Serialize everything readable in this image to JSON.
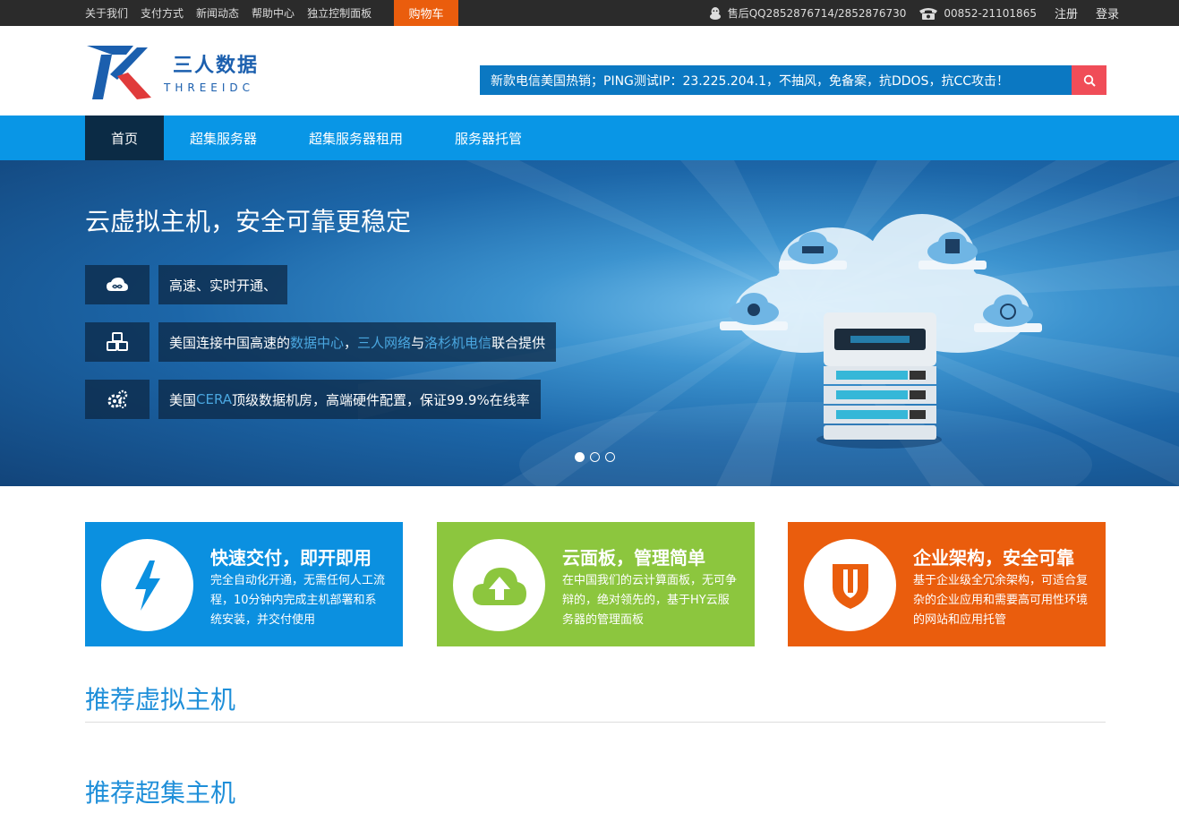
{
  "topbar": {
    "links": [
      "关于我们",
      "支付方式",
      "新闻动态",
      "帮助中心",
      "独立控制面板"
    ],
    "cart": "购物车",
    "qq": "售后QQ2852876714/2852876730",
    "phone": "00852-21101865",
    "register": "注册",
    "login": "登录"
  },
  "header": {
    "logo_cn": "三人数据",
    "logo_en": "THREEIDC",
    "marquee": "新款电信美国热销；PING测试IP：23.225.204.1，不抽风，免备案，抗DDOS，抗CC攻击！"
  },
  "nav": {
    "items": [
      "首页",
      "超集服务器",
      "超集服务器租用",
      "服务器托管"
    ]
  },
  "banner": {
    "title": "云虚拟主机，安全可靠更稳定",
    "features": [
      {
        "icon": "infinity-cloud-icon",
        "parts": [
          "高速、实时开通、"
        ]
      },
      {
        "icon": "cubes-icon",
        "parts": [
          "美国连接中国高速的",
          "数据中心",
          "，",
          "三人网络",
          "与",
          "洛杉机电信",
          "联合提供"
        ]
      },
      {
        "icon": "gears-icon",
        "parts": [
          "美国",
          "CERA",
          "顶级数据机房，高端硬件配置，保证99.9%在线率"
        ]
      }
    ],
    "active_slide": 1,
    "slide_count": 3
  },
  "cards": [
    {
      "title": "快速交付，即开即用",
      "desc": "完全自动化开通，无需任何人工流程，10分钟内完成主机部署和系统安装，并交付使用",
      "color": "#0b90e0",
      "icon": "lightning-icon"
    },
    {
      "title": "云面板，管理简单",
      "desc": "在中国我们的云计算面板，无可争辩的，绝对领先的，基于HY云服务器的管理面板",
      "color": "#8cc63e",
      "icon": "cloud-upload-icon"
    },
    {
      "title": "企业架构，安全可靠",
      "desc": "基于企业级全冗余架构，可适合复杂的企业应用和需要高可用性环境的网站和应用托管",
      "color": "#ea5d0d",
      "icon": "shield-icon"
    }
  ],
  "sections": {
    "virtual_hosts": "推荐虚拟主机",
    "super_hosts": "推荐超集主机"
  }
}
